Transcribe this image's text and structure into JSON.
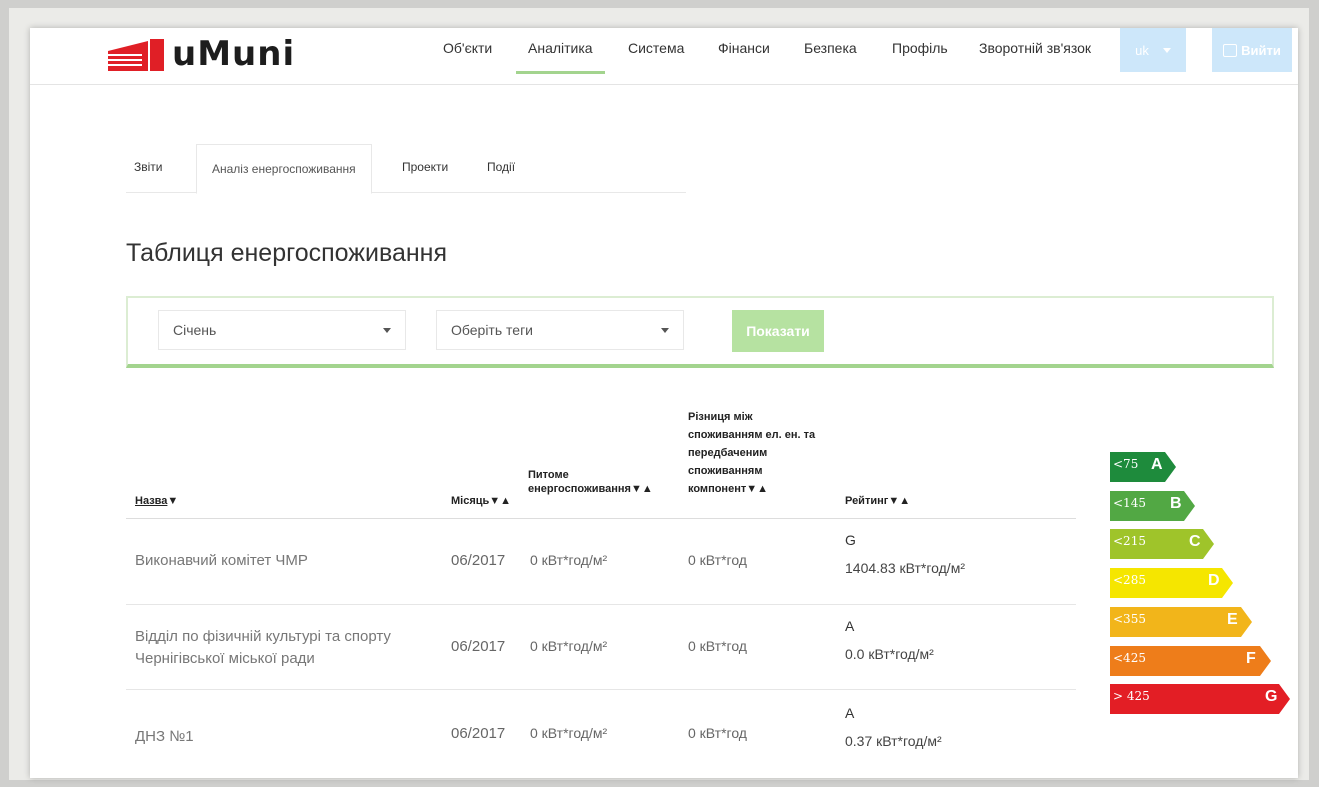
{
  "app": {
    "logo_text": "uMuni"
  },
  "nav": {
    "items": [
      "Об'єкти",
      "Аналітика",
      "Система",
      "Фінанси",
      "Безпека",
      "Профіль",
      "Зворотній зв'язок"
    ],
    "lang": "uk",
    "logout_label": "Вийти"
  },
  "tabs": [
    "Звіти",
    "Аналіз енергоспоживання",
    "Проекти",
    "Події"
  ],
  "title": "Таблиця енергоспоживання",
  "filters": {
    "month": "Січень",
    "tags_placeholder": "Оберіть теги",
    "show_label": "Показати"
  },
  "table": {
    "headers": {
      "name": "Назва",
      "month": "Місяць",
      "specific_lines": [
        "Питоме",
        "енергоспоживання"
      ],
      "difference_lines": [
        "Різниця між",
        "споживанням ел. ен. та",
        "передбаченим",
        "споживанням",
        "компонент"
      ],
      "rating": "Рейтинг"
    },
    "sort_desc": "▼",
    "sort_both": "▼▲",
    "rows": [
      {
        "name": "Виконавчий комітет ЧМР",
        "month": "06/2017",
        "specific": "0 кВт*год/м²",
        "difference": "0 кВт*год",
        "rating": "G",
        "rating_value": "1404.83 кВт*год/м²"
      },
      {
        "name": "Відділ по фізичній культурі та спорту Чернігівської міської ради",
        "month": "06/2017",
        "specific": "0 кВт*год/м²",
        "difference": "0 кВт*год",
        "rating": "A",
        "rating_value": "0.0 кВт*год/м²"
      },
      {
        "name": "ДНЗ №1",
        "month": "06/2017",
        "specific": "0 кВт*год/м²",
        "difference": "0 кВт*год",
        "rating": "A",
        "rating_value": "0.37 кВт*год/м²"
      }
    ]
  },
  "energy_scale": [
    {
      "threshold": "<75",
      "letter": "A",
      "color": "#1e8b3c"
    },
    {
      "threshold": "<145",
      "letter": "B",
      "color": "#52a844"
    },
    {
      "threshold": "<215",
      "letter": "C",
      "color": "#9fc42a"
    },
    {
      "threshold": "<285",
      "letter": "D",
      "color": "#f5e600"
    },
    {
      "threshold": "<355",
      "letter": "E",
      "color": "#f2b51a"
    },
    {
      "threshold": "<425",
      "letter": "F",
      "color": "#ee7d1a"
    },
    {
      "threshold": "> 425",
      "letter": "G",
      "color": "#e31e25"
    }
  ],
  "colors": {
    "accent": "#a3d48e",
    "button_blue": "#cde7fa"
  }
}
